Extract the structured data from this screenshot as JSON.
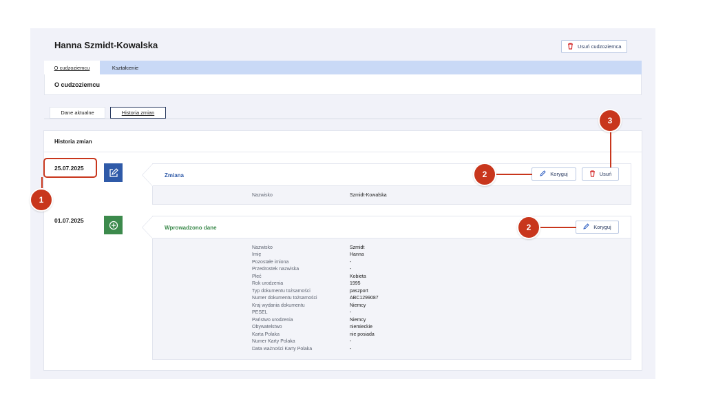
{
  "header": {
    "person_name": "Hanna Szmidt-Kowalska",
    "delete_button": "Usuń cudzoziemca"
  },
  "tabs": [
    {
      "label": "O cudzoziemcu"
    },
    {
      "label": "Kształcenie"
    }
  ],
  "section_title": "O cudzoziemcu",
  "subtabs": [
    {
      "label": "Dane aktualne"
    },
    {
      "label": "Historia zmian"
    }
  ],
  "history": {
    "title": "Historia zmian",
    "entries": [
      {
        "date": "25.07.2025",
        "title": "Zmiana",
        "icon": "edit-icon",
        "edit_label": "Koryguj",
        "delete_label": "Usuń",
        "rows": [
          {
            "label": "Nazwisko",
            "value": "Szmidt-Kowalska"
          }
        ]
      },
      {
        "date": "01.07.2025",
        "title": "Wprowadzono dane",
        "icon": "add-circle-icon",
        "edit_label": "Koryguj",
        "rows": [
          {
            "label": "Nazwisko",
            "value": "Szmidt"
          },
          {
            "label": "Imię",
            "value": "Hanna"
          },
          {
            "label": "Pozostałe imiona",
            "value": "-"
          },
          {
            "label": "Przedrostek nazwiska",
            "value": "-"
          },
          {
            "label": "Płeć",
            "value": "Kobieta"
          },
          {
            "label": "Rok urodzenia",
            "value": "1995"
          },
          {
            "label": "Typ dokumentu tożsamości",
            "value": "paszport"
          },
          {
            "label": "Numer dokumentu tożsamości",
            "value": "ABC1299087"
          },
          {
            "label": "Kraj wydania dokumentu",
            "value": "Niemcy"
          },
          {
            "label": "PESEL",
            "value": "-"
          },
          {
            "label": "Państwo urodzenia",
            "value": "Niemcy"
          },
          {
            "label": "Obywatelstwo",
            "value": "niemieckie"
          },
          {
            "label": "Karta Polaka",
            "value": "nie posiada"
          },
          {
            "label": "Numer Karty Polaka",
            "value": "-"
          },
          {
            "label": "Data ważności Karty Polaka",
            "value": "-"
          }
        ]
      }
    ]
  },
  "callouts": [
    "1",
    "2",
    "2",
    "3"
  ],
  "colors": {
    "accent_blue": "#2f5aa8",
    "accent_green": "#3c8a4c",
    "callout_red": "#c8361c",
    "tab_bar": "#c9d9f6"
  }
}
